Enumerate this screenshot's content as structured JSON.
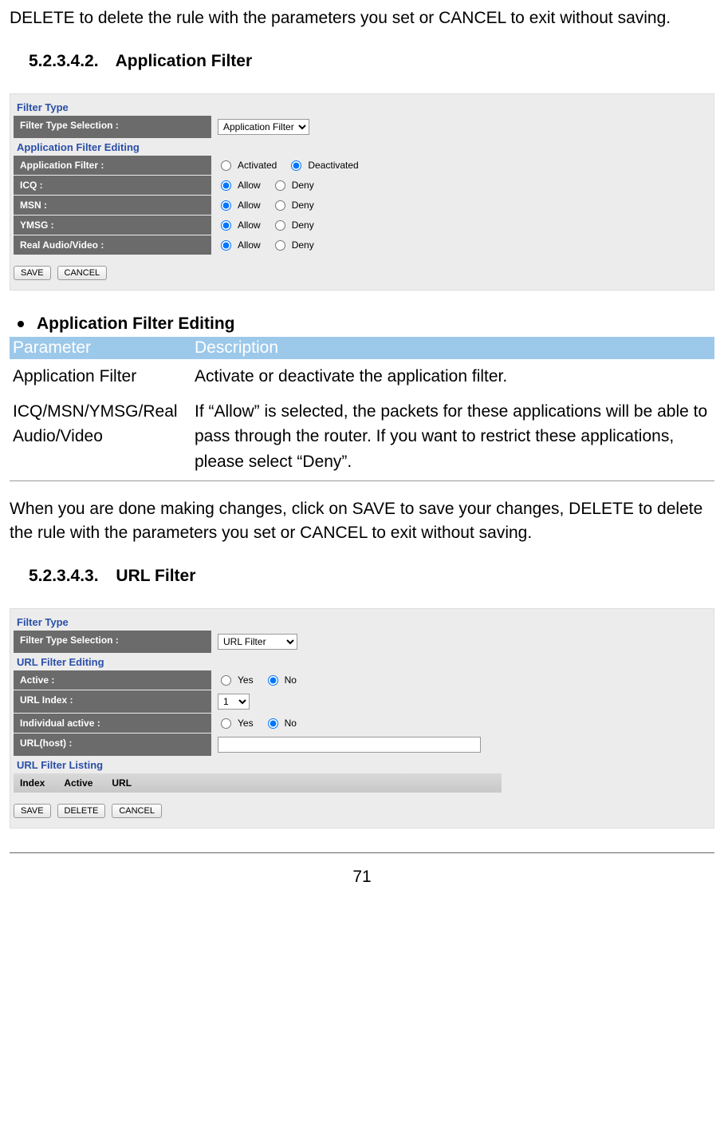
{
  "intro": "DELETE to delete the rule with the parameters you set or CANCEL to exit without saving.",
  "section1": {
    "number": "5.2.3.4.2.",
    "title": "Application Filter"
  },
  "panel_app": {
    "filter_type_sec": "Filter Type",
    "filter_type_label": "Filter Type Selection :",
    "filter_type_value": "Application Filter",
    "editing_sec": "Application Filter Editing",
    "rows": {
      "app_filter": {
        "label": "Application Filter :",
        "opt1": "Activated",
        "opt2": "Deactivated",
        "selected": "opt2"
      },
      "icq": {
        "label": "ICQ :",
        "opt1": "Allow",
        "opt2": "Deny",
        "selected": "opt1"
      },
      "msn": {
        "label": "MSN :",
        "opt1": "Allow",
        "opt2": "Deny",
        "selected": "opt1"
      },
      "ymsg": {
        "label": "YMSG :",
        "opt1": "Allow",
        "opt2": "Deny",
        "selected": "opt1"
      },
      "rav": {
        "label": "Real Audio/Video :",
        "opt1": "Allow",
        "opt2": "Deny",
        "selected": "opt1"
      }
    },
    "save": "SAVE",
    "cancel": "CANCEL"
  },
  "desc": {
    "heading": "Application Filter Editing",
    "th1": "Parameter",
    "th2": "Description",
    "r1p": "Application Filter",
    "r1d": "Activate or deactivate the application filter.",
    "r2p": "ICQ/MSN/YMSG/Real Audio/Video",
    "r2d": "If “Allow” is selected, the packets for these applications will be able to pass through the router. If you want to restrict these applications, please select “Deny”."
  },
  "body2": "When you are done making changes, click on SAVE to save your changes, DELETE to delete the rule with the parameters you set or CANCEL to exit without saving.",
  "section2": {
    "number": "5.2.3.4.3.",
    "title": "URL Filter"
  },
  "panel_url": {
    "filter_type_sec": "Filter Type",
    "filter_type_label": "Filter Type Selection :",
    "filter_type_value": "URL Filter",
    "editing_sec": "URL Filter Editing",
    "rows": {
      "active": {
        "label": "Active :",
        "opt1": "Yes",
        "opt2": "No",
        "selected": "opt2"
      },
      "url_index": {
        "label": "URL Index :",
        "value": "1"
      },
      "ind_active": {
        "label": "Individual active :",
        "opt1": "Yes",
        "opt2": "No",
        "selected": "opt2"
      },
      "url_host": {
        "label": "URL(host) :",
        "value": ""
      }
    },
    "listing_sec": "URL Filter Listing",
    "lh1": "Index",
    "lh2": "Active",
    "lh3": "URL",
    "save": "SAVE",
    "delete": "DELETE",
    "cancel": "CANCEL"
  },
  "page_number": "71"
}
